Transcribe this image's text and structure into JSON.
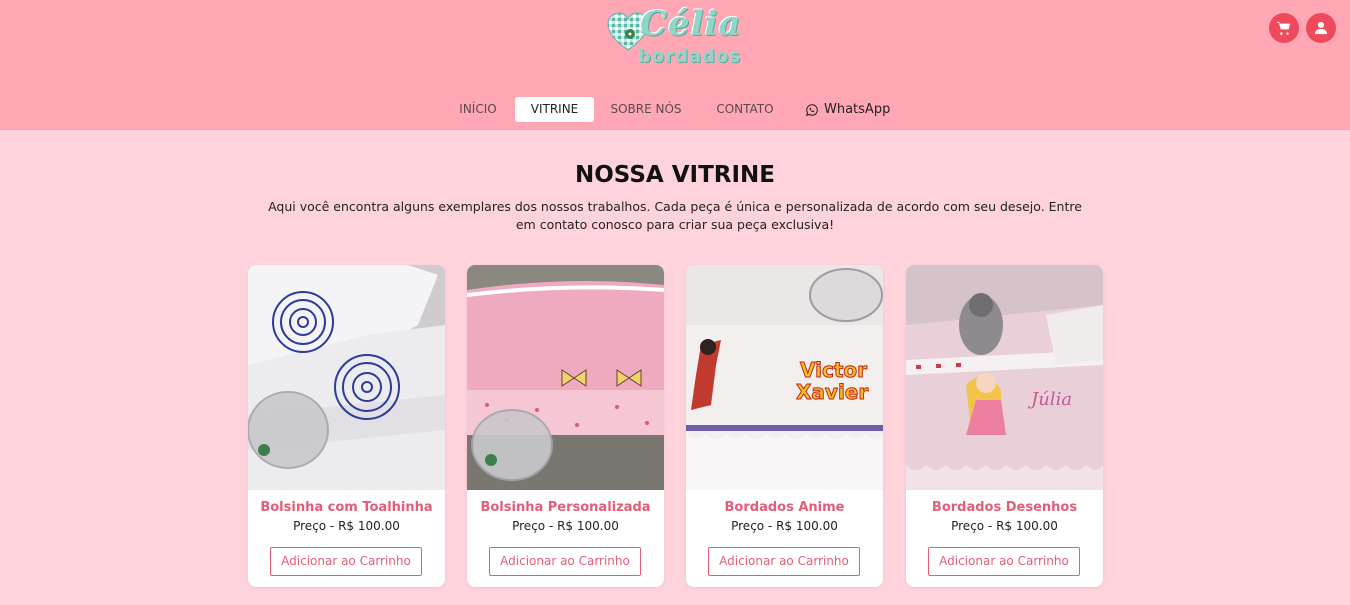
{
  "brand": {
    "logo_line1": "Célia",
    "logo_line2": "bordados"
  },
  "header_icons": [
    "cart-icon",
    "user-icon"
  ],
  "nav": {
    "items": [
      {
        "label": "INÍCIO",
        "active": false
      },
      {
        "label": "VITRINE",
        "active": true
      },
      {
        "label": "SOBRE NÓS",
        "active": false
      },
      {
        "label": "CONTATO",
        "active": false
      },
      {
        "label": "WhatsApp",
        "active": false,
        "icon": "whatsapp-icon"
      }
    ]
  },
  "main": {
    "title": "NOSSA VITRINE",
    "subtitle": "Aqui você encontra alguns exemplares dos nossos trabalhos. Cada peça é única e personalizada de acordo com seu desejo. Entre em contato conosco para criar sua peça exclusiva!"
  },
  "products": [
    {
      "name": "Bolsinha com Toalhinha",
      "price": "Preço - R$ 100.00",
      "button": "Adicionar ao Carrinho"
    },
    {
      "name": "Bolsinha Personalizada",
      "price": "Preço - R$ 100.00",
      "button": "Adicionar ao Carrinho"
    },
    {
      "name": "Bordados Anime",
      "price": "Preço - R$ 100.00",
      "button": "Adicionar ao Carrinho",
      "image_text": [
        "Victor",
        "Xavier"
      ]
    },
    {
      "name": "Bordados Desenhos",
      "price": "Preço - R$ 100.00",
      "button": "Adicionar ao Carrinho",
      "image_text": [
        "Júlia"
      ]
    }
  ],
  "colors": {
    "header_bg": "#ffa7b4",
    "page_bg": "#ffd3dc",
    "accent": "#e35d79",
    "icon_button": "#ef4a5b"
  }
}
